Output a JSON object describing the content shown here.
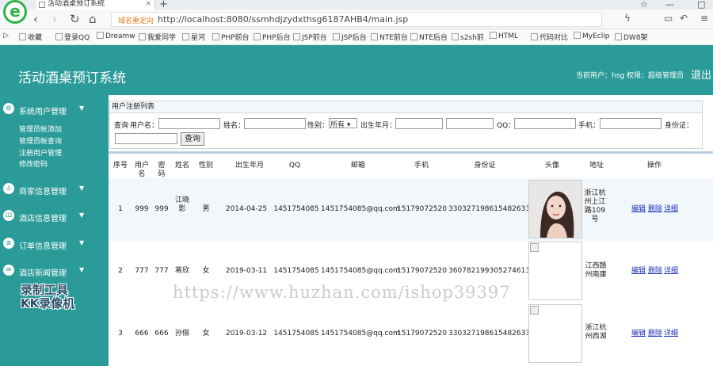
{
  "browser": {
    "logo_letter": "e",
    "tab_title": "活动酒桌预订系统",
    "tab_close": "×",
    "new_tab": "+",
    "url_tag": "域名重定向",
    "url": "http://localhost:8080/ssmhdjzydxthsg6187AHB4/main.jsp",
    "bookmarks": [
      "收藏",
      "登录QQ",
      "Dreamw",
      "我爱同学",
      "星河",
      "PHP前台",
      "PHP后台",
      "JSP前台",
      "JSP后台",
      "NTE前台",
      "NTE后台",
      "s2sh前",
      "HTML",
      "代码对比",
      "MyEclip",
      "DW8架"
    ]
  },
  "header": {
    "title": "活动酒桌预订系统",
    "user_info": "当前用户：hsg 权限：超级管理员",
    "logout": "退出"
  },
  "sidebar": {
    "menus": [
      {
        "label": "系统用户管理",
        "arrow": "▼",
        "icon": "gear-icon"
      },
      {
        "label": "商家信息管理",
        "arrow": "▼",
        "icon": "user-icon"
      },
      {
        "label": "酒店信息管理",
        "arrow": "▼",
        "icon": "building-icon"
      },
      {
        "label": "订单信息管理",
        "arrow": "▼",
        "icon": "order-icon"
      },
      {
        "label": "酒店新闻管理",
        "arrow": "▼",
        "icon": "news-icon"
      }
    ],
    "sub_items": [
      "管理员帐添加",
      "管理员帐查询",
      "注册用户管理",
      "修改密码"
    ]
  },
  "watermark": {
    "kk_line1": "录制工具",
    "kk_line2": "KK录像机",
    "url": "https://www.huzhan.com/ishop39397"
  },
  "panel": {
    "title": "用户注册列表",
    "search": {
      "query_label": "查询",
      "username_label": "用户名：",
      "name_label": "姓名：",
      "gender_label": "性别：",
      "gender_selected": "所有",
      "birth_label": "出生年月：",
      "qq_label": "QQ：",
      "phone_label": "手机：",
      "idcard_label": "身份证：",
      "button": "查询"
    }
  },
  "table": {
    "headers": [
      "序号",
      "用户名",
      "密码",
      "姓名",
      "性别",
      "出生年月",
      "QQ",
      "邮箱",
      "手机",
      "身份证",
      "头像",
      "地址",
      "操作"
    ],
    "rows": [
      {
        "no": "1",
        "username": "999",
        "password": "999",
        "name": "江晓影",
        "gender": "男",
        "birth": "2014-04-25",
        "qq": "1451754085",
        "email": "1451754085@qq.com",
        "phone": "15179072520",
        "idcard": "330327198615482633",
        "address": "浙江杭州上江路109号",
        "edit": "编辑",
        "delete": "删除",
        "detail": "详细"
      },
      {
        "no": "2",
        "username": "777",
        "password": "777",
        "name": "蒋欣",
        "gender": "女",
        "birth": "2019-03-11",
        "qq": "1451754085",
        "email": "1451754085@qq.com",
        "phone": "15179072520",
        "idcard": "360782199305274613",
        "address": "江西赣州南康",
        "edit": "编辑",
        "delete": "删除",
        "detail": "详细"
      },
      {
        "no": "3",
        "username": "666",
        "password": "666",
        "name": "孙俪",
        "gender": "女",
        "birth": "2019-03-12",
        "qq": "1451754085",
        "email": "1451754085@qq.com",
        "phone": "15179072520",
        "idcard": "330327198615482633",
        "address": "浙江杭州西湖",
        "edit": "编辑",
        "delete": "删除",
        "detail": "详细"
      }
    ]
  }
}
